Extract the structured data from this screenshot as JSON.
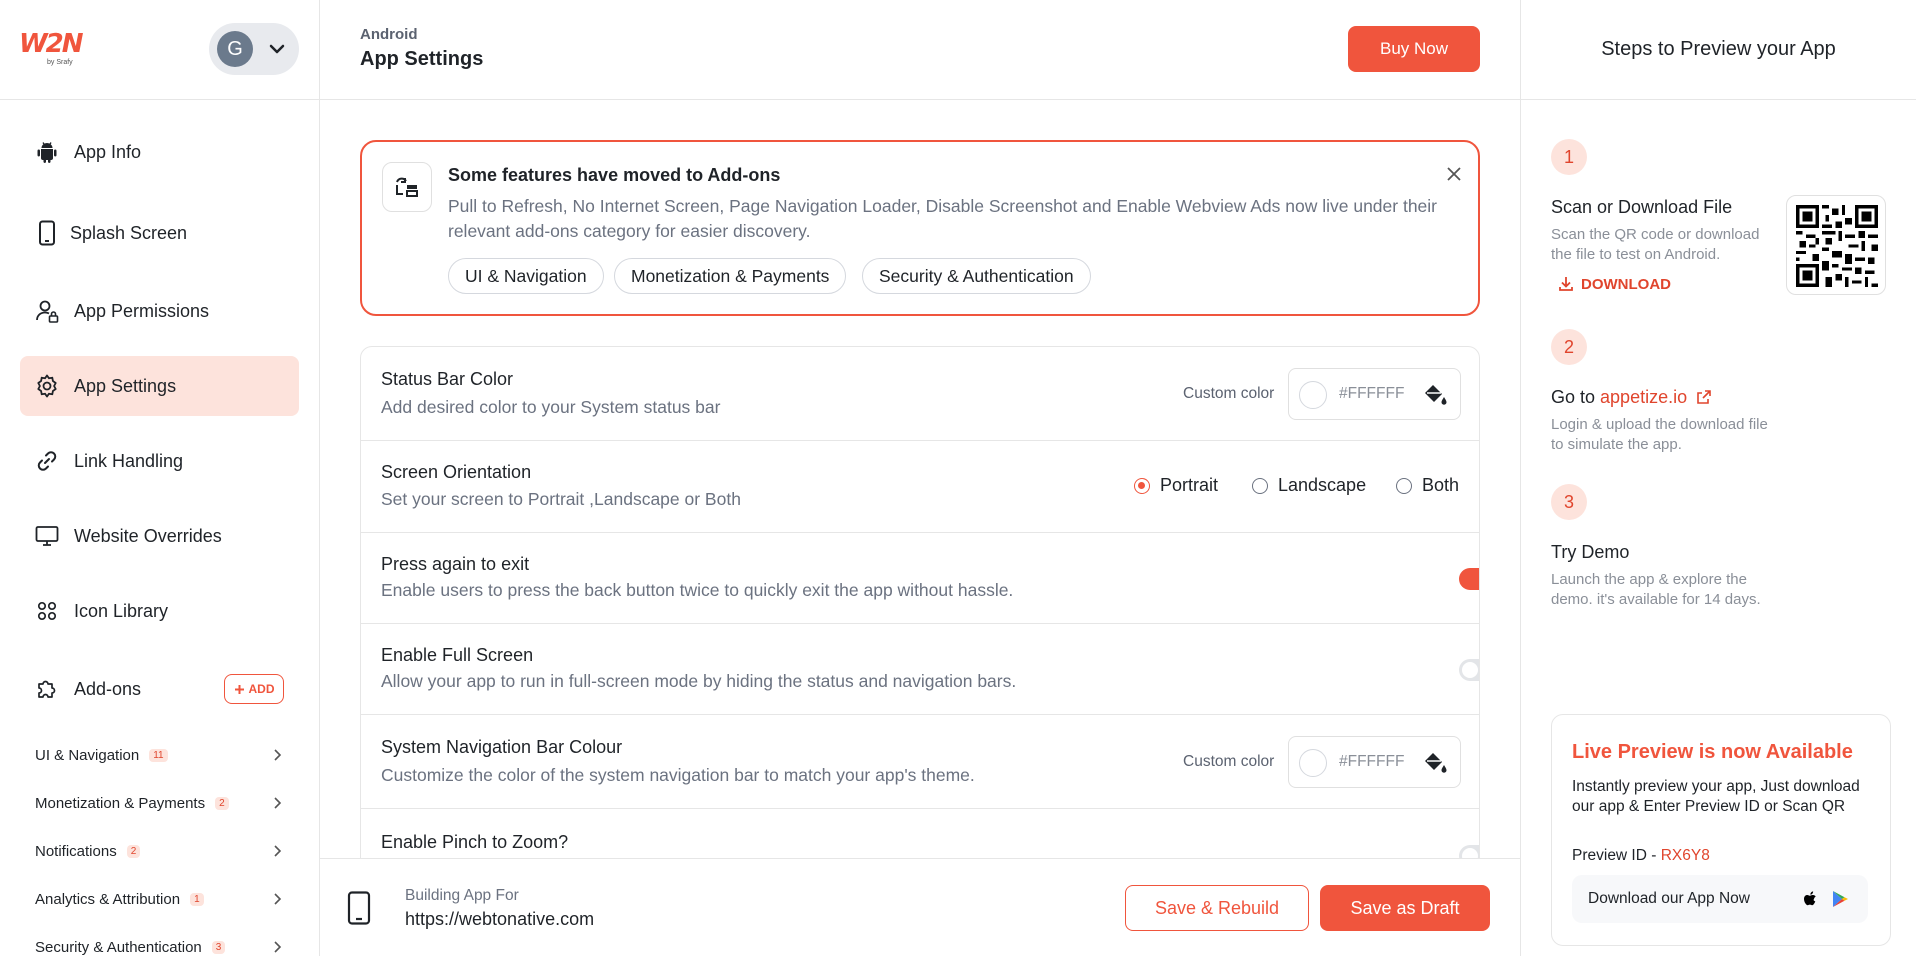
{
  "brand": {
    "logo_text": "W2N",
    "logo_sub": "by Srafy",
    "accent": "#f0553d"
  },
  "user": {
    "initial": "G"
  },
  "nav": {
    "items": [
      {
        "label": "App Info"
      },
      {
        "label": "Splash Screen"
      },
      {
        "label": "App Permissions"
      },
      {
        "label": "App Settings",
        "active": true
      },
      {
        "label": "Link Handling"
      },
      {
        "label": "Website Overrides"
      },
      {
        "label": "Icon Library"
      },
      {
        "label": "Add-ons"
      }
    ],
    "add_label": "ADD",
    "categories": [
      {
        "label": "UI & Navigation",
        "count": "11"
      },
      {
        "label": "Monetization & Payments",
        "count": "2"
      },
      {
        "label": "Notifications",
        "count": "2"
      },
      {
        "label": "Analytics & Attribution",
        "count": "1"
      },
      {
        "label": "Security & Authentication",
        "count": "3"
      }
    ]
  },
  "header": {
    "platform": "Android",
    "title": "App Settings",
    "buy_label": "Buy Now"
  },
  "notice": {
    "title": "Some features have moved to Add-ons",
    "text": "Pull to Refresh, No Internet Screen, Page Navigation Loader, Disable Screenshot and Enable Webview Ads now live under their relevant add-ons category for easier discovery.",
    "chips": [
      "UI & Navigation",
      "Monetization & Payments",
      "Security & Authentication"
    ]
  },
  "settings": {
    "status_bar": {
      "title": "Status Bar Color",
      "desc": "Add desired color to your System status bar",
      "custom_label": "Custom color",
      "hex": "#FFFFFF"
    },
    "orientation": {
      "title": "Screen Orientation",
      "desc": "Set your screen to Portrait ,Landscape or Both",
      "options": [
        "Portrait",
        "Landscape",
        "Both"
      ],
      "selected": "Portrait"
    },
    "press_exit": {
      "title": "Press again to exit",
      "desc": "Enable users to press the back button twice to quickly exit the app without hassle.",
      "enabled": true
    },
    "full_screen": {
      "title": "Enable Full Screen",
      "desc": "Allow your app to run in full-screen mode by hiding the status and navigation bars.",
      "enabled": false
    },
    "nav_bar": {
      "title": "System Navigation Bar Colour",
      "desc": "Customize the color of the system navigation bar to match your app's theme.",
      "custom_label": "Custom color",
      "hex": "#FFFFFF"
    },
    "pinch_zoom": {
      "title": "Enable Pinch to Zoom?",
      "enabled": false
    }
  },
  "footer": {
    "build_label": "Building App For",
    "url": "https://webtonative.com",
    "rebuild_label": "Save & Rebuild",
    "draft_label": "Save as Draft"
  },
  "preview": {
    "title": "Steps to Preview your App",
    "steps": [
      {
        "num": "1",
        "title": "Scan or Download File",
        "desc": "Scan the QR code or download the file to test on Android.",
        "link": "DOWNLOAD"
      },
      {
        "num": "2",
        "title_prefix": "Go to ",
        "link": "appetize.io",
        "desc": "Login & upload the download file to simulate the app."
      },
      {
        "num": "3",
        "title": "Try Demo",
        "desc": "Launch the app & explore the demo. it's available for 14 days."
      }
    ],
    "live": {
      "title": "Live Preview is now Available",
      "text": "Instantly preview your app, Just download our app & Enter Preview ID or Scan QR",
      "pid_label": "Preview ID - ",
      "pid": "RX6Y8",
      "download_label": "Download our App Now"
    }
  }
}
